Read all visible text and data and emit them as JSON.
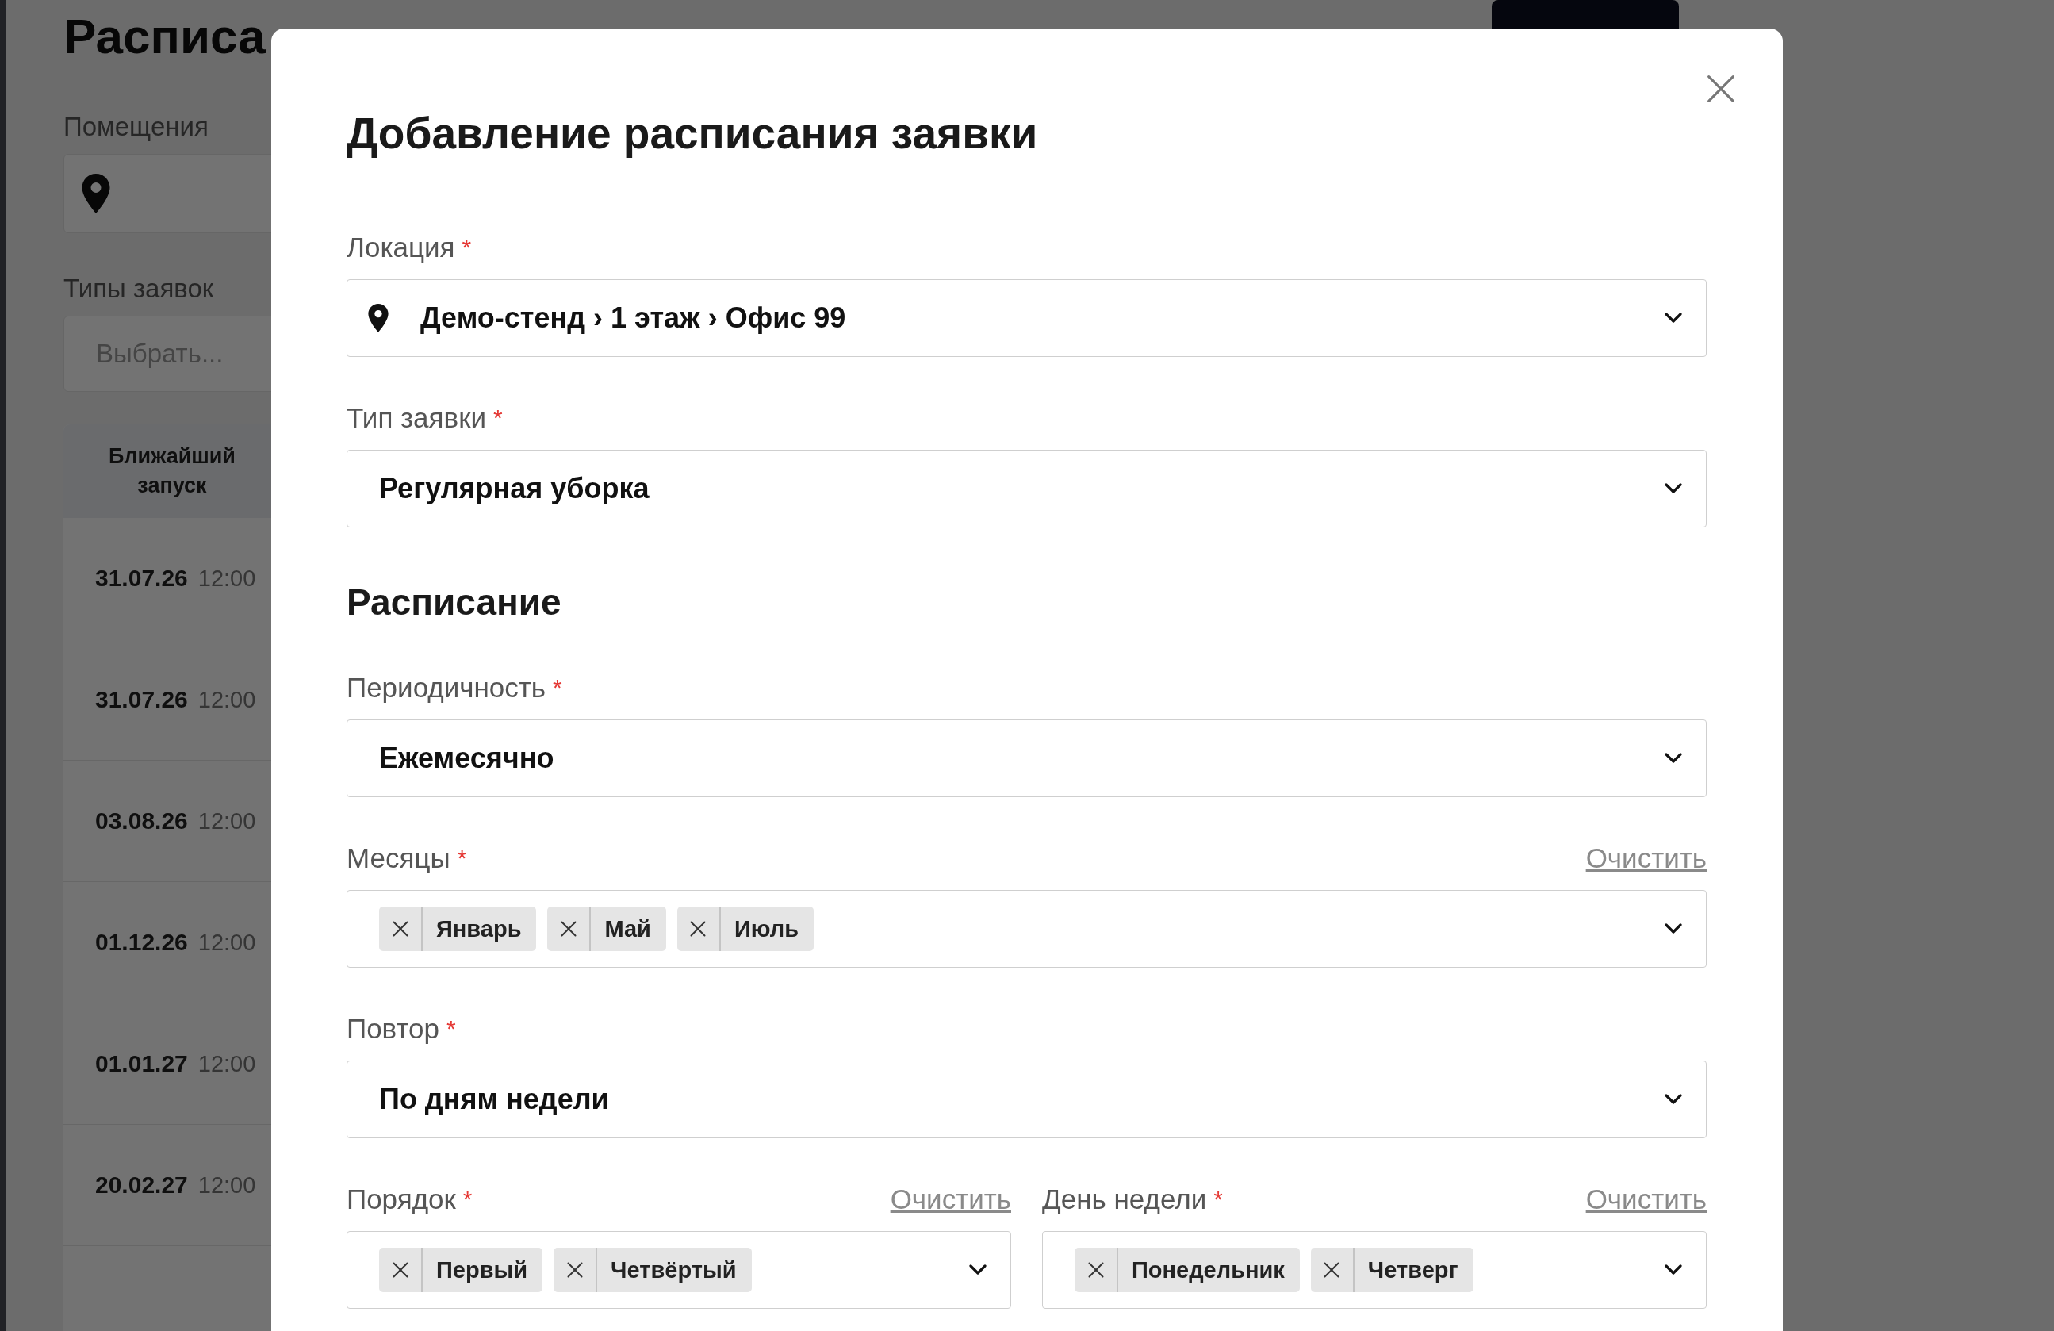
{
  "background_page": {
    "title": "Расписа",
    "filters": [
      {
        "kind": "location",
        "label": "Помещения"
      },
      {
        "kind": "select",
        "label": "Типы заявок",
        "placeholder": "Выбрать..."
      }
    ],
    "table": {
      "columns": [
        "Ближайший запуск"
      ],
      "rows": [
        {
          "date": "31.07.26",
          "time": "12:00"
        },
        {
          "date": "31.07.26",
          "time": "12:00"
        },
        {
          "date": "03.08.26",
          "time": "12:00"
        },
        {
          "date": "01.12.26",
          "time": "12:00"
        },
        {
          "date": "01.01.27",
          "time": "12:00"
        },
        {
          "date": "20.02.27",
          "time": "12:00"
        }
      ]
    }
  },
  "dialog": {
    "title": "Добавление расписания заявки",
    "fields": [
      {
        "kind": "location",
        "label": "Локация",
        "required_mark": "*",
        "value": "Демо-стенд › 1 этаж › Офис 99"
      },
      {
        "kind": "select",
        "label": "Тип заявки",
        "required_mark": "*",
        "value": "Регулярная уборка"
      }
    ],
    "schedule": {
      "heading": "Расписание",
      "fields": [
        {
          "kind": "select",
          "label": "Периодичность",
          "required_mark": "*",
          "value": "Ежемесячно"
        },
        {
          "kind": "multi",
          "label": "Месяцы",
          "required_mark": "*",
          "clear_link": "Очистить",
          "chips": [
            "Январь",
            "Май",
            "Июль"
          ]
        },
        {
          "kind": "select",
          "label": "Повтор",
          "required_mark": "*",
          "value": "По дням недели"
        }
      ],
      "columns": [
        {
          "kind": "multi",
          "label": "Порядок",
          "required_mark": "*",
          "clear_link": "Очистить",
          "chips": [
            "Первый",
            "Четвёртый"
          ]
        },
        {
          "kind": "multi",
          "label": "День недели",
          "required_mark": "*",
          "clear_link": "Очистить",
          "chips": [
            "Понедельник",
            "Четверг"
          ]
        }
      ]
    }
  }
}
